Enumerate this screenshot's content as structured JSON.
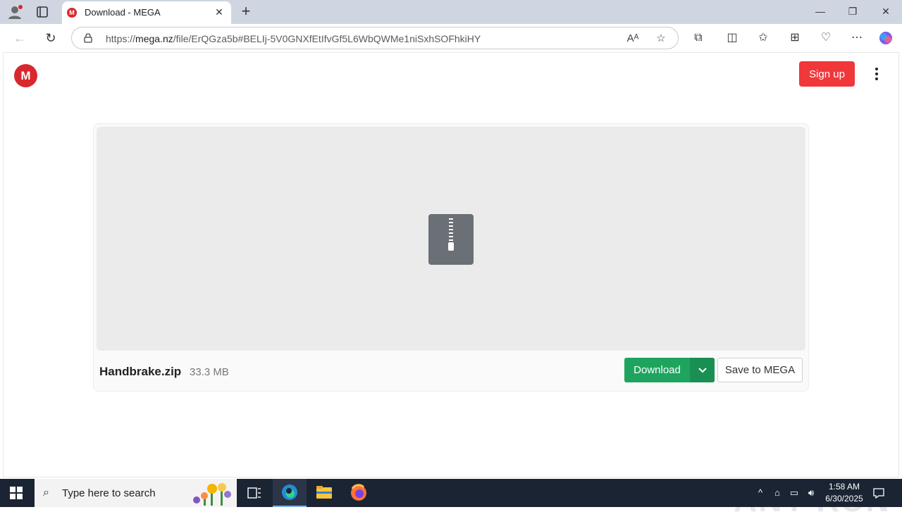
{
  "browser": {
    "tab": {
      "title": "Download - MEGA",
      "favicon_letter": "M"
    },
    "address": {
      "url_prefix": "https://",
      "url_host": "mega.nz",
      "url_path": "/file/ErQGza5b#BELIj-5V0GNXfEtIfvGf5L6WbQWMe1niSxhSOFhkiHY"
    }
  },
  "page": {
    "logo_letter": "M",
    "signup_label": "Sign up",
    "file": {
      "name": "Handbrake.zip",
      "size": "33.3 MB"
    },
    "download_label": "Download",
    "save_label": "Save to MEGA",
    "watermark": "ANY RUN"
  },
  "taskbar": {
    "search_placeholder": "Type here to search",
    "time": "1:58 AM",
    "date": "6/30/2025"
  },
  "colors": {
    "mega_red": "#d9272e",
    "signup_red": "#f0373a",
    "download_green": "#1fa45f",
    "taskbar": "#1b2433"
  }
}
